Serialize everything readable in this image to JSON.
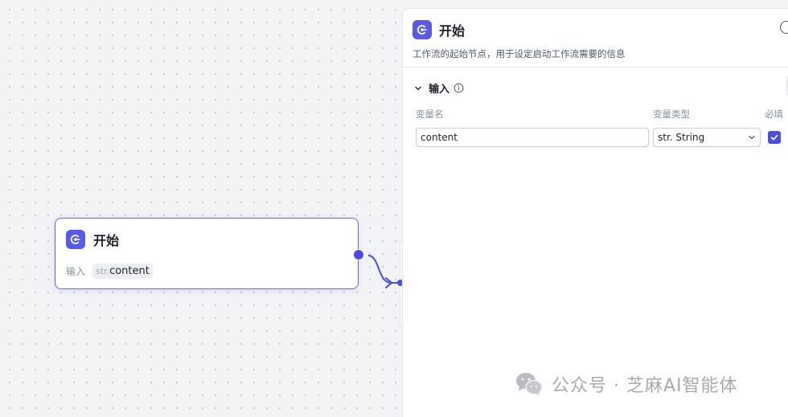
{
  "node": {
    "title": "开始",
    "input_label": "输入",
    "var_type": "str.",
    "var_name": "content",
    "icon": "start-flow-icon"
  },
  "panel": {
    "title": "开始",
    "description": "工作流的起始节点，用于设定启动工作流需要的信息",
    "icon": "start-flow-icon",
    "section": {
      "title": "输入",
      "columns": {
        "name": "变量名",
        "type": "变量类型",
        "required": "必填"
      },
      "rows": [
        {
          "name": "content",
          "type": "str. String",
          "required": true
        }
      ]
    }
  },
  "watermark": {
    "text": "公众号 · 芝麻AI智能体",
    "icon": "wechat-icon"
  },
  "colors": {
    "accent": "#4b4ce8",
    "node_border": "#6a5ff0",
    "panel_bg": "#ffffff",
    "canvas_bg": "#f2f3f5"
  }
}
